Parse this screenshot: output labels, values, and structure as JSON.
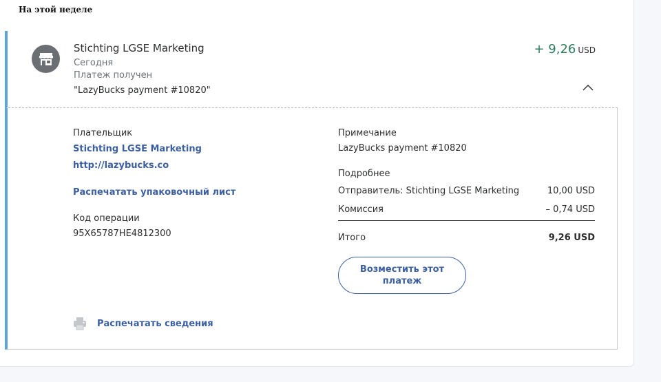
{
  "section": {
    "heading": "На этой неделе"
  },
  "transaction": {
    "merchant": "Stichting LGSE Marketing",
    "date": "Сегодня",
    "status": "Платеж получен",
    "note": "\"LazyBucks payment #10820\"",
    "amount": "+ 9,26",
    "currency": "USD",
    "amount_color": "#2e7d5f",
    "merchant_icon": "storefront-icon",
    "toggle_icon": "chevron-up-icon"
  },
  "details": {
    "payer_label": "Плательщик",
    "payer_name": "Stichting LGSE Marketing",
    "payer_url": "http://lazybucks.co",
    "print_packing_slip": "Распечатать упаковочный лист",
    "txn_id_label": "Код операции",
    "txn_id": "95X65787HE4812300",
    "note_label": "Примечание",
    "note_value": "LazyBucks payment #10820",
    "more_label": "Подробнее",
    "sender_label": "Отправитель: Stichting LGSE Marketing",
    "sender_amount": "10,00 USD",
    "fee_label": "Комиссия",
    "fee_amount": "– 0,74 USD",
    "total_label": "Итого",
    "total_amount": "9,26 USD",
    "refund_button": "Возместить этот платеж",
    "print_details": "Распечатать сведения",
    "print_icon": "printer-icon"
  },
  "colors": {
    "accent_bar": "#5aa5d9",
    "link": "#3b5fa0",
    "positive": "#2e7d5f"
  }
}
